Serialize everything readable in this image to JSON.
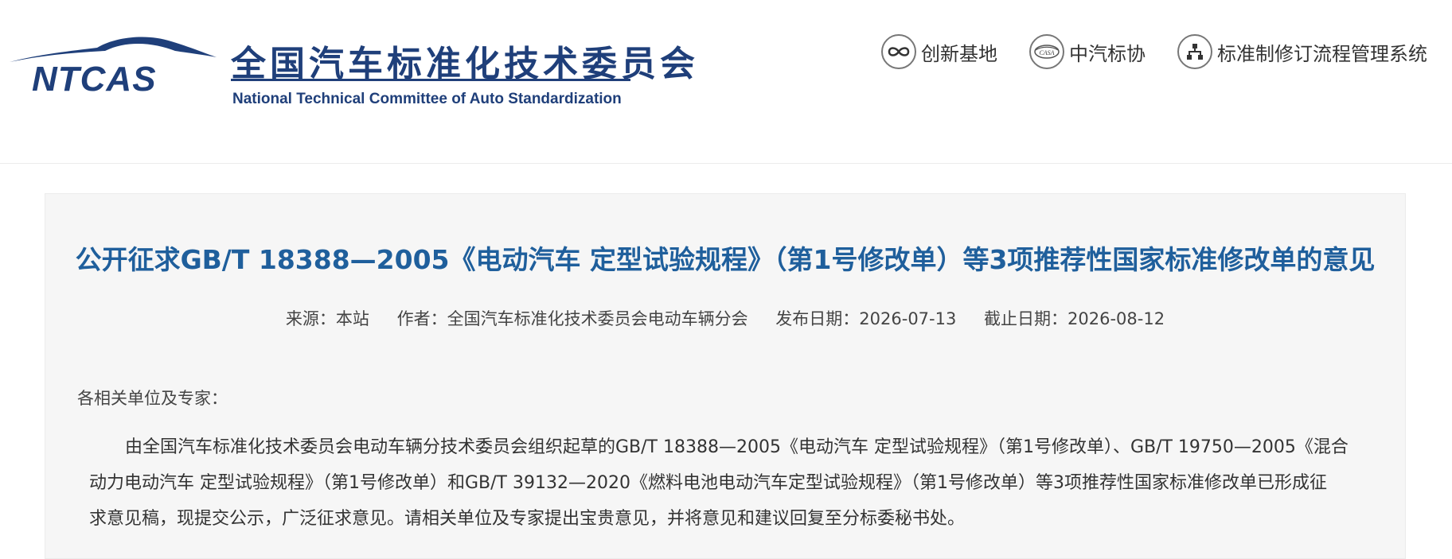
{
  "header": {
    "logo_text": "NTCAS",
    "title_cn": "全国汽车标准化技术委员会",
    "title_en": "National Technical Committee of Auto Standardization",
    "links": [
      {
        "label": "创新基地",
        "icon": "infinity-icon"
      },
      {
        "label": "中汽标协",
        "icon": "casa-logo-icon",
        "icon_text": "CASA"
      },
      {
        "label": "标准制修订流程管理系统",
        "icon": "flowchart-icon"
      }
    ]
  },
  "article": {
    "title": "公开征求GB/T 18388—2005《电动汽车 定型试验规程》（第1号修改单）等3项推荐性国家标准修改单的意见",
    "meta": {
      "source": "来源：本站",
      "author": "作者：全国汽车标准化技术委员会电动车辆分会",
      "publish_date": "发布日期：2026-07-13",
      "deadline": "截止日期：2026-08-12"
    },
    "salutation": "各相关单位及专家：",
    "body_lines": [
      "由全国汽车标准化技术委员会电动车辆分技术委员会组织起草的GB/T 18388—2005《电动汽车 定型试验规程》（第1号修改单）、GB/T 19750—2005《混合",
      "动力电动汽车 定型试验规程》（第1号修改单）和GB/T 39132—2020《燃料电池电动汽车定型试验规程》（第1号修改单）等3项推荐性国家标准修改单已形成征",
      "求意见稿，现提交公示，广泛征求意见。请相关单位及专家提出宝贵意见，并将意见和建议回复至分标委秘书处。"
    ]
  },
  "colors": {
    "brand_navy": "#1f3f7a",
    "title_blue": "#1f5f9c",
    "card_bg": "#f6f6f6"
  }
}
